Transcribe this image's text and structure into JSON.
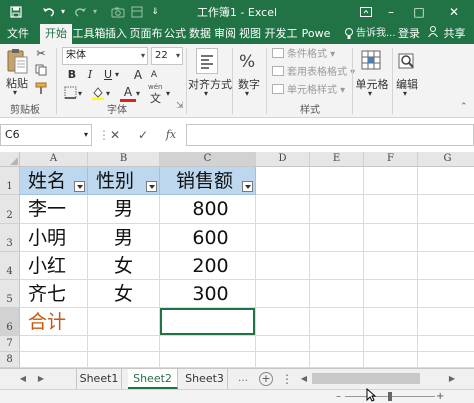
{
  "titlebar": {
    "title": "工作簿1 - Excel",
    "save_icon": "save-icon",
    "undo_icon": "undo-icon",
    "redo_icon": "redo-icon",
    "camera_icon": "camera-icon",
    "account_icon": "account-icon"
  },
  "tabs": {
    "items": [
      "文件",
      "开始",
      "工具箱",
      "插入",
      "页面布",
      "公式",
      "数据",
      "审阅",
      "视图",
      "开发工",
      "Powe"
    ],
    "active": "开始",
    "tell_me": "告诉我...",
    "login": "登录",
    "share": "共享"
  },
  "ribbon": {
    "paste_label": "粘贴",
    "clipboard_label": "剪贴板",
    "font_name": "宋体",
    "font_size": "22",
    "bold": "B",
    "italic": "I",
    "underline": "U",
    "grow_font": "A",
    "shrink_font": "A",
    "font_color_letter": "A",
    "wen_glyph": "wén",
    "font_group_label": "字体",
    "alignment_label": "对齐方式",
    "number_label": "数字",
    "cond_format": "条件格式",
    "table_format": "套用表格格式",
    "cell_styles": "单元格样式",
    "styles_group_label": "样式",
    "cells_label": "单元格",
    "editing_label": "编辑"
  },
  "formula_bar": {
    "name_box": "C6",
    "cancel_icon": "✕",
    "enter_icon": "✓",
    "fx_label": "fx",
    "formula": ""
  },
  "sheet": {
    "columns": [
      "A",
      "B",
      "C",
      "D",
      "E",
      "F",
      "G"
    ],
    "rows": [
      "1",
      "2",
      "3",
      "4",
      "5",
      "6",
      "7",
      "8"
    ],
    "header": [
      "姓名",
      "性别",
      "销售额"
    ],
    "data": [
      [
        "李一",
        "男",
        "800"
      ],
      [
        "小明",
        "男",
        "600"
      ],
      [
        "小红",
        "女",
        "200"
      ],
      [
        "齐七",
        "女",
        "300"
      ]
    ],
    "total_label": "合计",
    "total_color": "#c65911",
    "header_fill": "#bdd7ee",
    "active_cell": "C6"
  },
  "sheet_tabs": {
    "items": [
      "Sheet1",
      "Sheet2",
      "Sheet3"
    ],
    "active": "Sheet2",
    "add_symbol": "+"
  },
  "colors": {
    "brand": "#217346"
  }
}
